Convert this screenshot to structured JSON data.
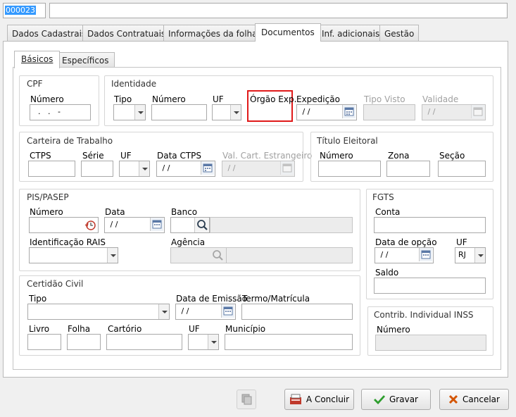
{
  "top": {
    "code": "000023",
    "name": ""
  },
  "tabs": [
    "Dados Cadastrais",
    "Dados Contratuais",
    "Informações da folha",
    "Documentos",
    "Inf. adicionais",
    "Gestão"
  ],
  "subtabs": [
    "Básicos",
    "Específicos"
  ],
  "cpf": {
    "title": "CPF",
    "numero_label": "Número",
    "numero_value": "  .   .   -"
  },
  "identidade": {
    "title": "Identidade",
    "tipo": "Tipo",
    "numero": "Número",
    "uf": "UF",
    "orgao": "Órgão Exp.",
    "expedicao": "Expedição",
    "expedicao_value": " / /",
    "tipo_visto": "Tipo Visto",
    "validade": "Validade",
    "validade_value": " / /"
  },
  "ctps": {
    "title": "Carteira de Trabalho",
    "ctps": "CTPS",
    "serie": "Série",
    "uf": "UF",
    "data": "Data CTPS",
    "data_value": " / /",
    "val": "Val. Cart. Estrangeiro",
    "val_value": " / /"
  },
  "titulo": {
    "title": "Título Eleitoral",
    "numero": "Número",
    "zona": "Zona",
    "secao": "Seção"
  },
  "pis": {
    "title": "PIS/PASEP",
    "numero": "Número",
    "data": "Data",
    "data_value": " / /",
    "banco": "Banco",
    "rais": "Identificação RAIS",
    "agencia": "Agência"
  },
  "fgts": {
    "title": "FGTS",
    "conta": "Conta",
    "data_opcao": "Data de opção",
    "data_value": " / /",
    "uf": "UF",
    "uf_value": "RJ",
    "saldo": "Saldo"
  },
  "certidao": {
    "title": "Certidão Civil",
    "tipo": "Tipo",
    "data_emissao": "Data de Emissão",
    "data_value": " / /",
    "termo": "Termo/Matrícula",
    "livro": "Livro",
    "folha": "Folha",
    "cartorio": "Cartório",
    "uf": "UF",
    "municipio": "Município"
  },
  "inss": {
    "title": "Contrib. Individual INSS",
    "numero": "Número"
  },
  "buttons": {
    "concluir": "A Concluir",
    "gravar": "Gravar",
    "cancelar": "Cancelar"
  }
}
